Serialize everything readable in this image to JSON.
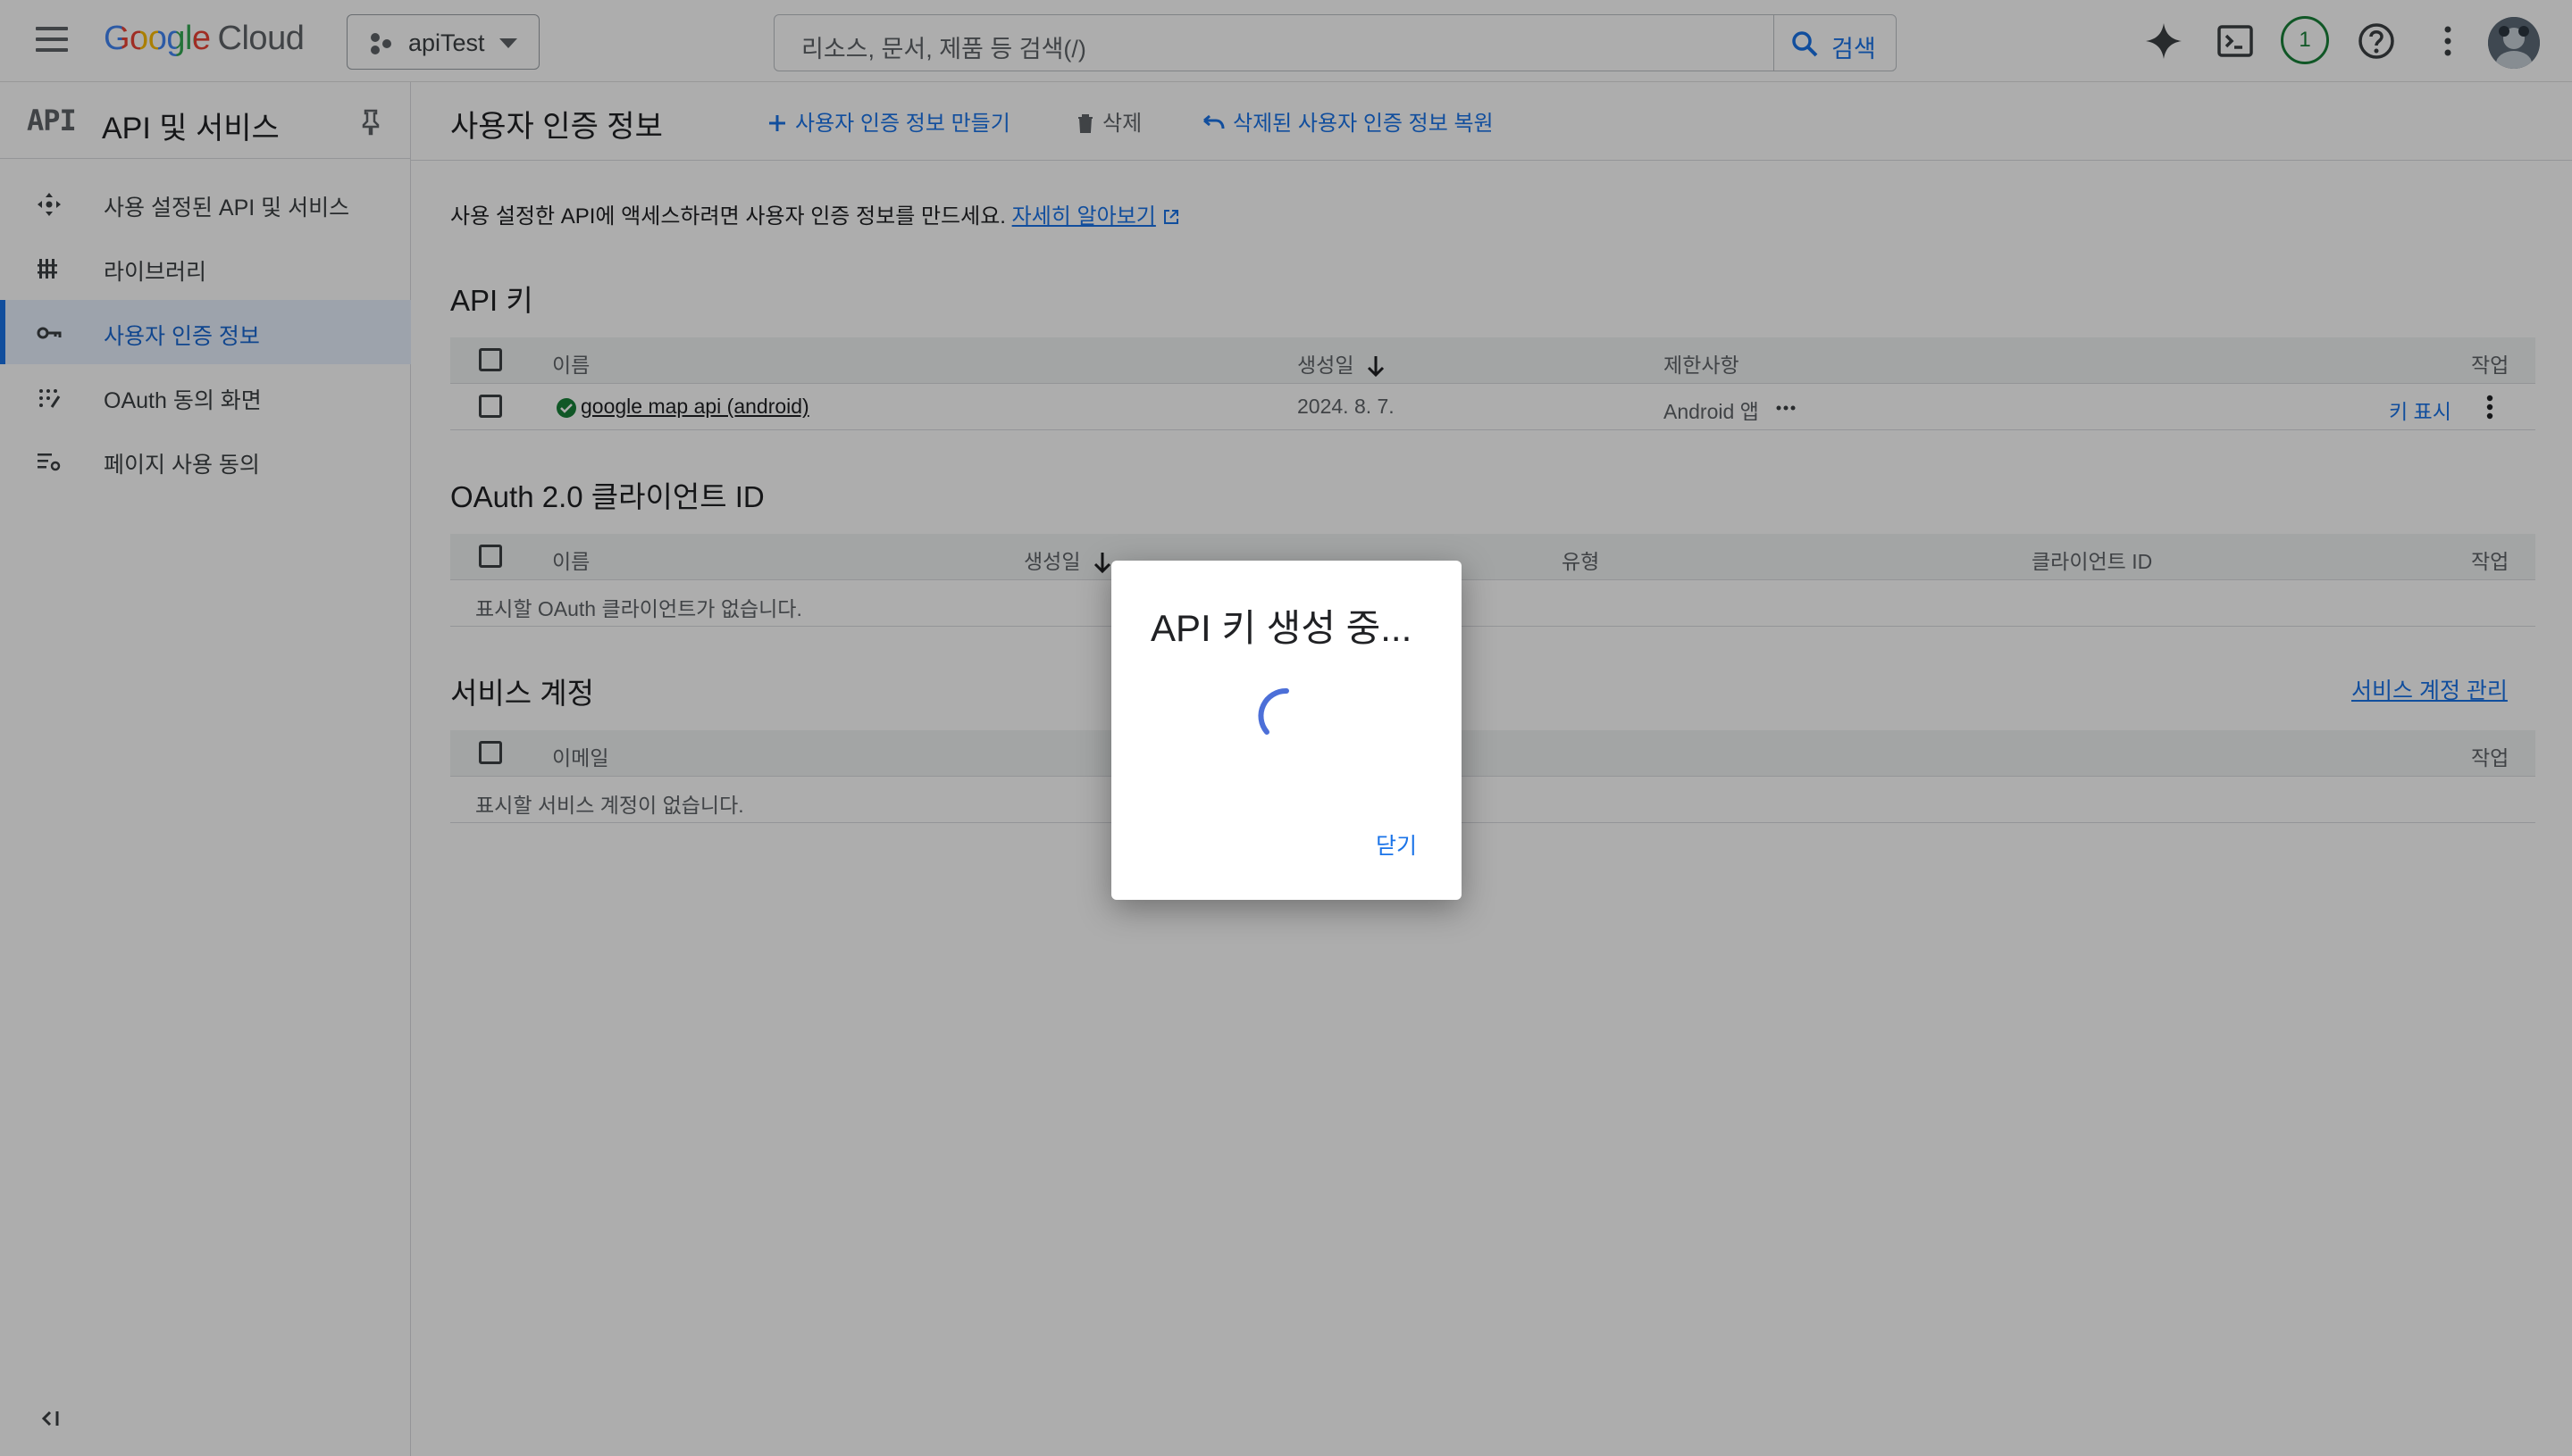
{
  "topbar": {
    "logo_google": "Google",
    "logo_cloud": "Cloud",
    "project_name": "apiTest",
    "search_placeholder": "리소스, 문서, 제품 등 검색(/)",
    "search_button": "검색",
    "notification_count": "1"
  },
  "sidebar": {
    "logo": "API",
    "title": "API 및 서비스",
    "items": [
      {
        "label": "사용 설정된 API 및 서비스",
        "icon": "diamond-arrows-icon",
        "active": false
      },
      {
        "label": "라이브러리",
        "icon": "library-icon",
        "active": false
      },
      {
        "label": "사용자 인증 정보",
        "icon": "key-icon",
        "active": true
      },
      {
        "label": "OAuth 동의 화면",
        "icon": "oauth-dots-icon",
        "active": false
      },
      {
        "label": "페이지 사용 동의",
        "icon": "settings-list-icon",
        "active": false
      }
    ]
  },
  "main": {
    "title": "사용자 인증 정보",
    "actions": {
      "create": "사용자 인증 정보 만들기",
      "delete": "삭제",
      "restore": "삭제된 사용자 인증 정보 복원"
    },
    "intro_text": "사용 설정한 API에 액세스하려면 사용자 인증 정보를 만드세요.",
    "intro_link": "자세히 알아보기",
    "api_keys": {
      "title": "API 키",
      "headers": {
        "name": "이름",
        "created": "생성일",
        "restrictions": "제한사항",
        "actions": "작업"
      },
      "rows": [
        {
          "name": "google map api (android)",
          "created": "2024. 8. 7.",
          "restriction": "Android 앱",
          "show_key": "키 표시"
        }
      ]
    },
    "oauth": {
      "title": "OAuth 2.0 클라이언트 ID",
      "headers": {
        "name": "이름",
        "created": "생성일",
        "type": "유형",
        "client_id": "클라이언트 ID",
        "actions": "작업"
      },
      "empty": "표시할 OAuth 클라이언트가 없습니다."
    },
    "service_accounts": {
      "title": "서비스 계정",
      "manage_link": "서비스 계정 관리",
      "headers": {
        "email": "이메일",
        "actions": "작업"
      },
      "empty": "표시할 서비스 계정이 없습니다."
    }
  },
  "dialog": {
    "title": "API 키 생성 중...",
    "close": "닫기"
  },
  "colors": {
    "accent": "#1a73e8",
    "active_bg": "#e8f0fe",
    "success": "#188038",
    "overlay": "rgba(0,0,0,0.32)"
  }
}
